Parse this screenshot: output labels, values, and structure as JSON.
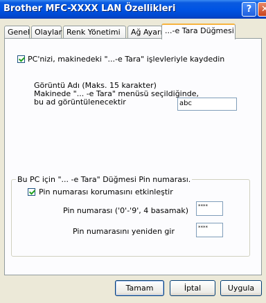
{
  "window": {
    "title": "Brother MFC-XXXX   LAN Özellikleri",
    "help_glyph": "?",
    "close_glyph": "✕"
  },
  "tabs": [
    {
      "label": "Genel"
    },
    {
      "label": "Olaylar"
    },
    {
      "label": "Renk Yönetimi"
    },
    {
      "label": "Ağ Ayarı"
    },
    {
      "label": "...-e Tara Düğmesi",
      "active": true
    }
  ],
  "scan_register": {
    "label": "PC'nizi, makinedeki \"...-e Tara\" işlevleriyle kaydedin",
    "checked": true
  },
  "display_name": {
    "line1": "Görüntü Adı (Maks. 15 karakter)",
    "line2": "Makinede \"... -e Tara\" menüsü seçildiğinde,",
    "line3": "bu ad görüntülenecektir",
    "value": "abc"
  },
  "pin_group": {
    "legend": "Bu PC için \"... -e Tara\" Düğmesi Pin numarası.",
    "enable_label": "Pin numarası korumasını etkinleştir",
    "enable_checked": true,
    "pin_label": "Pin numarası ('0'-'9', 4 basamak)",
    "pin_value": "****",
    "pin_reenter_label": "Pin numarasını yeniden gir",
    "pin_reenter_value": "****"
  },
  "buttons": {
    "ok": "Tamam",
    "cancel": "İptal",
    "apply": "Uygula"
  }
}
